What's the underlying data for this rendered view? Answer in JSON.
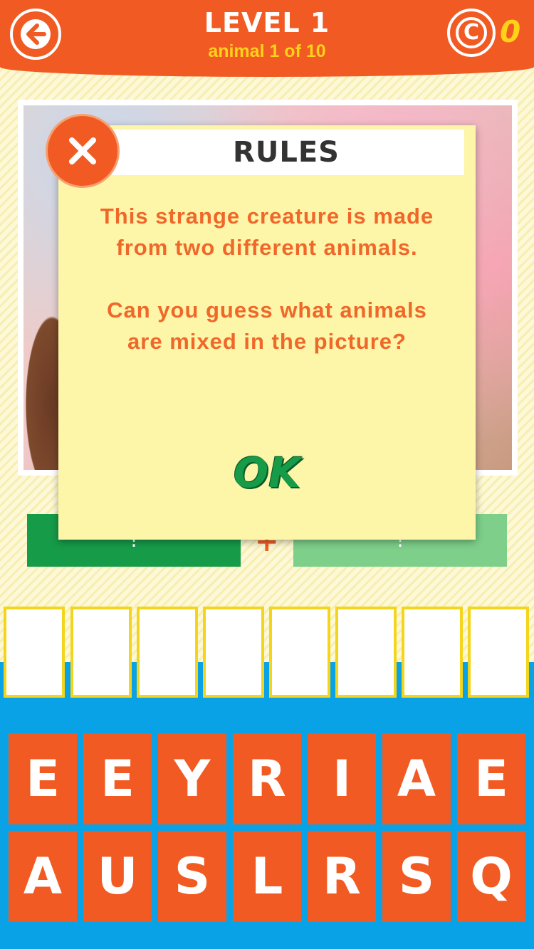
{
  "header": {
    "title": "LEVEL 1",
    "subtitle": "animal 1 of 10",
    "coins": "0",
    "coin_symbol": "C",
    "back_icon": "back-arrow-icon",
    "coin_icon": "coin-icon"
  },
  "answers": {
    "first_placeholder": "!",
    "second_placeholder": "!",
    "separator": "+"
  },
  "slots_count": 8,
  "keyboard": {
    "row1": [
      "E",
      "E",
      "Y",
      "R",
      "I",
      "A",
      "E"
    ],
    "row2": [
      "A",
      "U",
      "S",
      "L",
      "R",
      "S",
      "Q"
    ]
  },
  "modal": {
    "title": "RULES",
    "paragraph1": "This strange creature is made from two different animals.",
    "paragraph2": "Can you guess what animals are mixed in the picture?",
    "ok_label": "OK",
    "close_icon": "close-icon"
  },
  "colors": {
    "primary_orange": "#f15b23",
    "accent_yellow": "#ffd21a",
    "green": "#169b49",
    "light_green": "#7dcf8a",
    "blue": "#0aa2e6",
    "modal_bg": "#fdf5a8"
  }
}
